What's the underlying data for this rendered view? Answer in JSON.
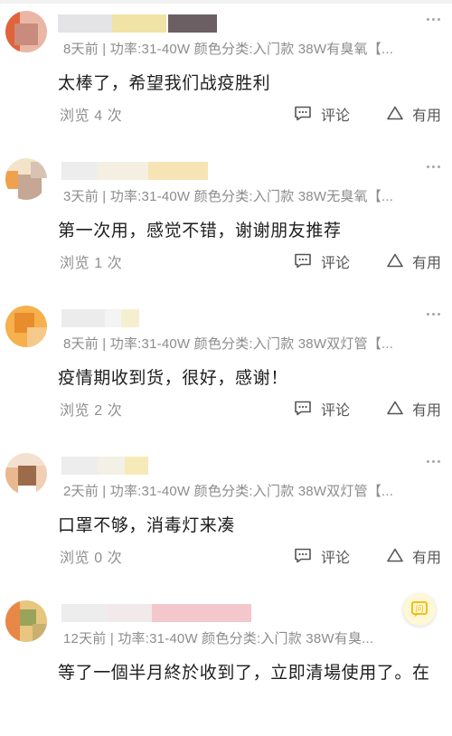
{
  "reviews": [
    {
      "meta": "8天前 | 功率:31-40W 颜色分类:入门款 38W有臭氧【...",
      "content": "太棒了，希望我们战疫胜利",
      "views": "浏览 4 次",
      "comment_label": "评论",
      "useful_label": "有用"
    },
    {
      "meta": "3天前 | 功率:31-40W 颜色分类:入门款 38W无臭氧【...",
      "content": "第一次用，感觉不错，谢谢朋友推荐",
      "views": "浏览 1 次",
      "comment_label": "评论",
      "useful_label": "有用"
    },
    {
      "meta": "8天前 | 功率:31-40W 颜色分类:入门款 38W双灯管【...",
      "content": "疫情期收到货，很好，感谢！",
      "views": "浏览 2 次",
      "comment_label": "评论",
      "useful_label": "有用"
    },
    {
      "meta": "2天前 | 功率:31-40W 颜色分类:入门款 38W双灯管【...",
      "content": "口罩不够，消毒灯来凑",
      "views": "浏览 0 次",
      "comment_label": "评论",
      "useful_label": "有用"
    },
    {
      "meta": "12天前 | 功率:31-40W 颜色分类:入门款 38W有臭...",
      "content": "等了一個半月終於收到了，立即清場使用了。在",
      "views": "",
      "comment_label": "",
      "useful_label": ""
    }
  ],
  "floating_button": {
    "label": "问",
    "color": "#f5b400"
  },
  "colors": {
    "meta_text": "#8c8c8c",
    "content_text": "#1e1e1e",
    "action_text": "#555555"
  },
  "icons": {
    "more": "more-dots-icon",
    "comment": "comment-bubble-icon",
    "useful": "triangle-useful-icon"
  }
}
